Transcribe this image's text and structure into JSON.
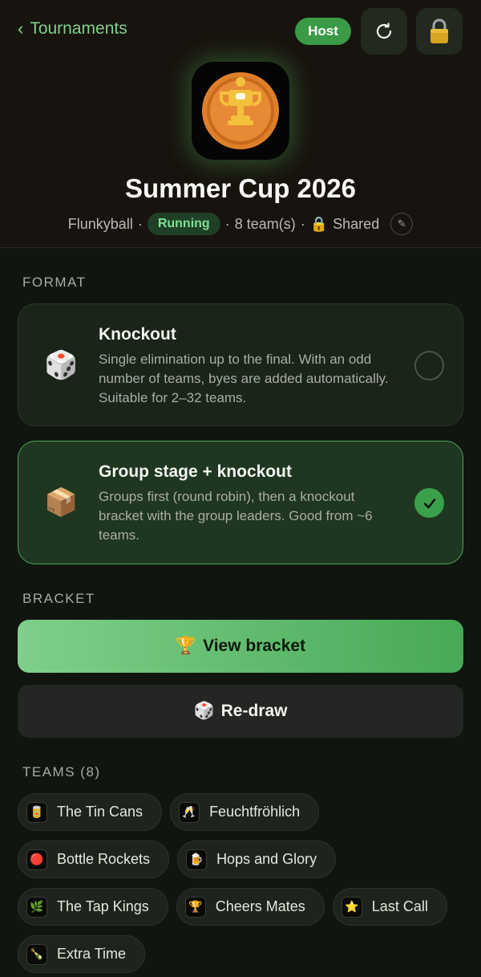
{
  "header": {
    "back_label": "Tournaments",
    "back_chevron": "‹",
    "host_badge": "Host",
    "title": "Summer Cup 2026",
    "meta": {
      "sport": "Flunkyball",
      "sep1": "·",
      "status": "Running",
      "sep2": "·",
      "teams": "8 team(s)",
      "sep3": "·",
      "lock_emoji": "🔒",
      "share": "Shared",
      "edit_glyph": "✎"
    }
  },
  "format": {
    "label": "FORMAT",
    "options": [
      {
        "emoji": "🎲",
        "title": "Knockout",
        "description": "Single elimination up to the final. With an odd number of teams, byes are added automatically. Suitable for 2–32 teams.",
        "selected": false
      },
      {
        "emoji": "📦",
        "title": "Group stage + knockout",
        "description": "Groups first (round robin), then a knockout bracket with the group leaders. Good from ~6 teams.",
        "selected": true
      }
    ]
  },
  "bracket": {
    "label": "BRACKET",
    "view_emoji": "🏆",
    "view_label": "View bracket",
    "redraw_emoji": "🎲",
    "redraw_label": "Re-draw"
  },
  "teams": {
    "label": "TEAMS (8)",
    "items": [
      {
        "name": "The Tin Cans",
        "icon": "🥫"
      },
      {
        "name": "Feuchtfröhlich",
        "icon": "🥂"
      },
      {
        "name": "Bottle Rockets",
        "icon": "🔴"
      },
      {
        "name": "Hops and Glory",
        "icon": "🍺"
      },
      {
        "name": "The Tap Kings",
        "icon": "🌿"
      },
      {
        "name": "Cheers Mates",
        "icon": "🏆"
      },
      {
        "name": "Last Call",
        "icon": "⭐"
      },
      {
        "name": "Extra Time",
        "icon": "🍾"
      }
    ]
  },
  "colors": {
    "accent": "#7fd08a",
    "accent_dark": "#3aa04a",
    "background": "#101510",
    "header_bg": "#17130e"
  }
}
